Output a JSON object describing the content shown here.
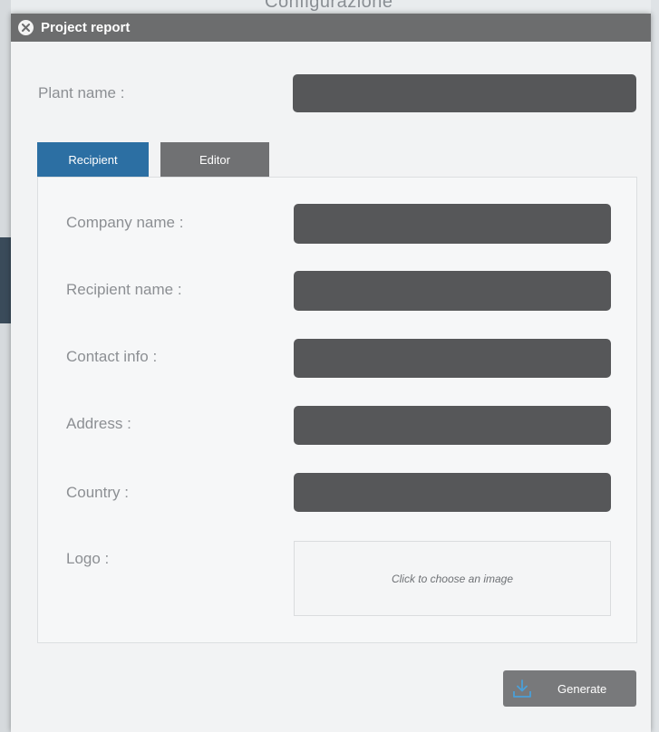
{
  "background": {
    "title": "Configurazione"
  },
  "dialog": {
    "title": "Project report",
    "plant_name_label": "Plant name :",
    "plant_name_value": ""
  },
  "tabs": [
    {
      "label": "Recipient",
      "active": true
    },
    {
      "label": "Editor",
      "active": false
    }
  ],
  "recipient": {
    "company_name_label": "Company name :",
    "company_name_value": "",
    "recipient_name_label": "Recipient name :",
    "recipient_name_value": "",
    "contact_info_label": "Contact info :",
    "contact_info_value": "",
    "address_label": "Address :",
    "address_value": "",
    "country_label": "Country :",
    "country_value": "",
    "logo_label": "Logo :",
    "logo_hint": "Click to choose an image"
  },
  "actions": {
    "generate_label": "Generate",
    "generate_icon": "download-icon"
  },
  "colors": {
    "accent": "#2c6fa3",
    "titlebar": "#6c6d6e",
    "input_bg": "#565759",
    "icon_blue": "#4a9fd8"
  }
}
